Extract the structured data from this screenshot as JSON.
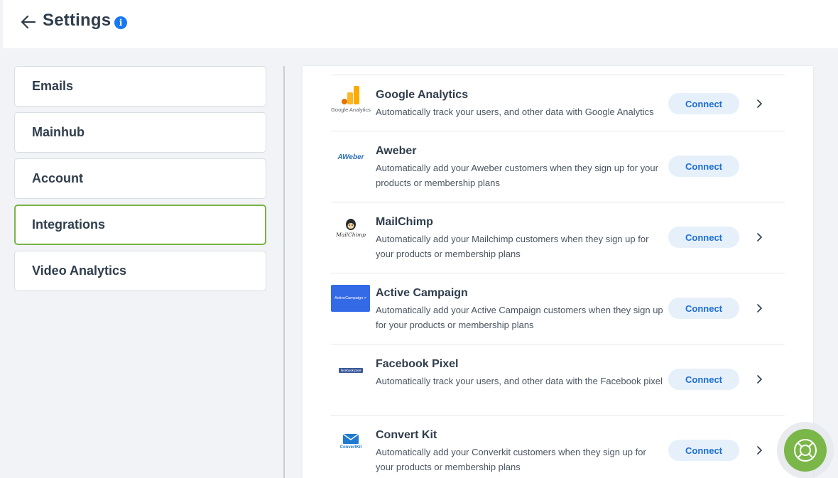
{
  "header": {
    "title": "Settings",
    "back_icon": "arrow-left-icon",
    "info_icon": "info-icon",
    "info_glyph": "i"
  },
  "sidebar": {
    "items": [
      {
        "label": "Emails",
        "active": false
      },
      {
        "label": "Mainhub",
        "active": false
      },
      {
        "label": "Account",
        "active": false
      },
      {
        "label": "Integrations",
        "active": true
      },
      {
        "label": "Video Analytics",
        "active": false
      }
    ],
    "active_border_color": "#78b346"
  },
  "integrations": [
    {
      "name": "Google Analytics",
      "logo_caption": "Google Analytics",
      "description": "Automatically track your users, and other data with Google Analytics",
      "button": "Connect",
      "has_chevron": true
    },
    {
      "name": "Aweber",
      "logo_caption": "AWeber",
      "description": "Automatically add your Aweber customers when they sign up for your products or membership plans",
      "button": "Connect",
      "has_chevron": false
    },
    {
      "name": "MailChimp",
      "logo_caption": "MailChimp",
      "description": "Automatically add your Mailchimp customers when they sign up for your products or membership plans",
      "button": "Connect",
      "has_chevron": true
    },
    {
      "name": "Active Campaign",
      "logo_caption": "ActiveCampaign >",
      "description": "Automatically add your Active Campaign customers when they sign up for your products or membership plans",
      "button": "Connect",
      "has_chevron": true
    },
    {
      "name": "Facebook Pixel",
      "logo_caption": "facebook pixel",
      "description": "Automatically track your users, and other data with the Facebook pixel",
      "button": "Connect",
      "has_chevron": true
    },
    {
      "name": "Convert Kit",
      "logo_caption": "ConvertKit",
      "description": "Automatically add your Converkit customers when they sign up for your products or membership plans",
      "button": "Connect",
      "has_chevron": true
    }
  ],
  "help": {
    "icon": "lifebuoy-icon",
    "color": "#7ab648"
  },
  "colors": {
    "accent_blue": "#1877f2",
    "button_bg": "#e6f0fb",
    "button_text": "#1c6fd4"
  }
}
